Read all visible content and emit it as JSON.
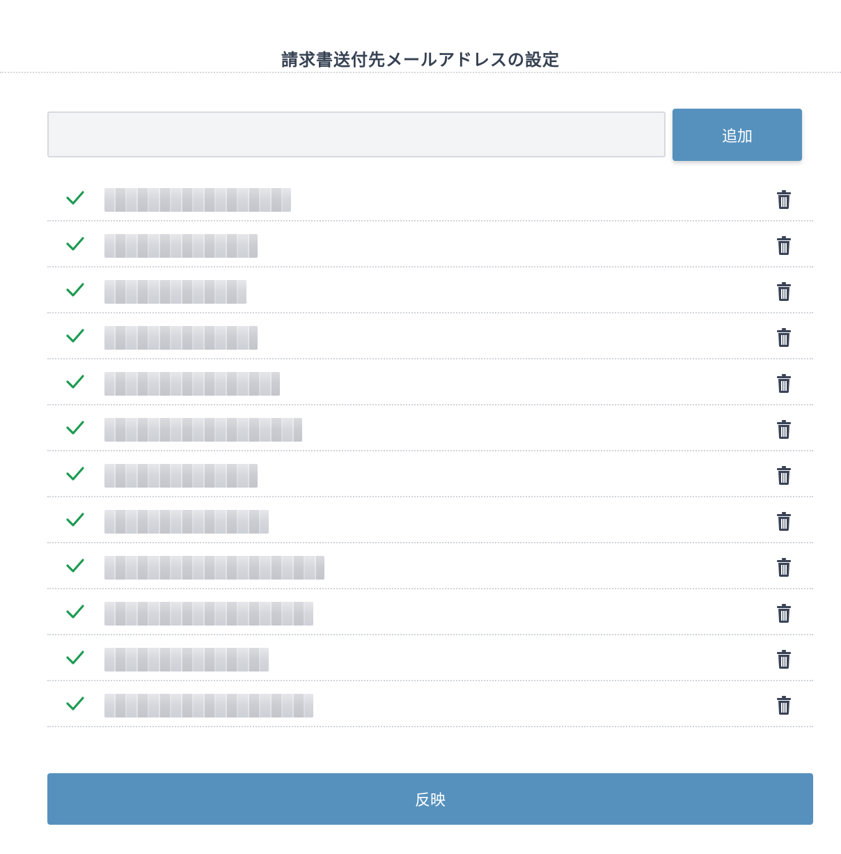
{
  "header": {
    "title": "請求書送付先メールアドレスの設定"
  },
  "form": {
    "email_value": "",
    "email_placeholder": "",
    "add_label": "追加"
  },
  "emails": {
    "items": [
      {
        "address": "",
        "status": "check-icon",
        "action": "trash-icon"
      },
      {
        "address": "",
        "status": "check-icon",
        "action": "trash-icon"
      },
      {
        "address": "",
        "status": "check-icon",
        "action": "trash-icon"
      },
      {
        "address": "",
        "status": "check-icon",
        "action": "trash-icon"
      },
      {
        "address": "",
        "status": "check-icon",
        "action": "trash-icon"
      },
      {
        "address": "",
        "status": "check-icon",
        "action": "trash-icon"
      },
      {
        "address": "",
        "status": "check-icon",
        "action": "trash-icon"
      },
      {
        "address": "",
        "status": "check-icon",
        "action": "trash-icon"
      },
      {
        "address": "",
        "status": "check-icon",
        "action": "trash-icon"
      },
      {
        "address": "",
        "status": "check-icon",
        "action": "trash-icon"
      },
      {
        "address": "",
        "status": "check-icon",
        "action": "trash-icon"
      },
      {
        "address": "",
        "status": "check-icon",
        "action": "trash-icon"
      }
    ]
  },
  "footer": {
    "apply_label": "反映"
  },
  "colors": {
    "primary": "#5691be",
    "check": "#1e9a52",
    "trash": "#3a4356",
    "title": "#364152"
  }
}
